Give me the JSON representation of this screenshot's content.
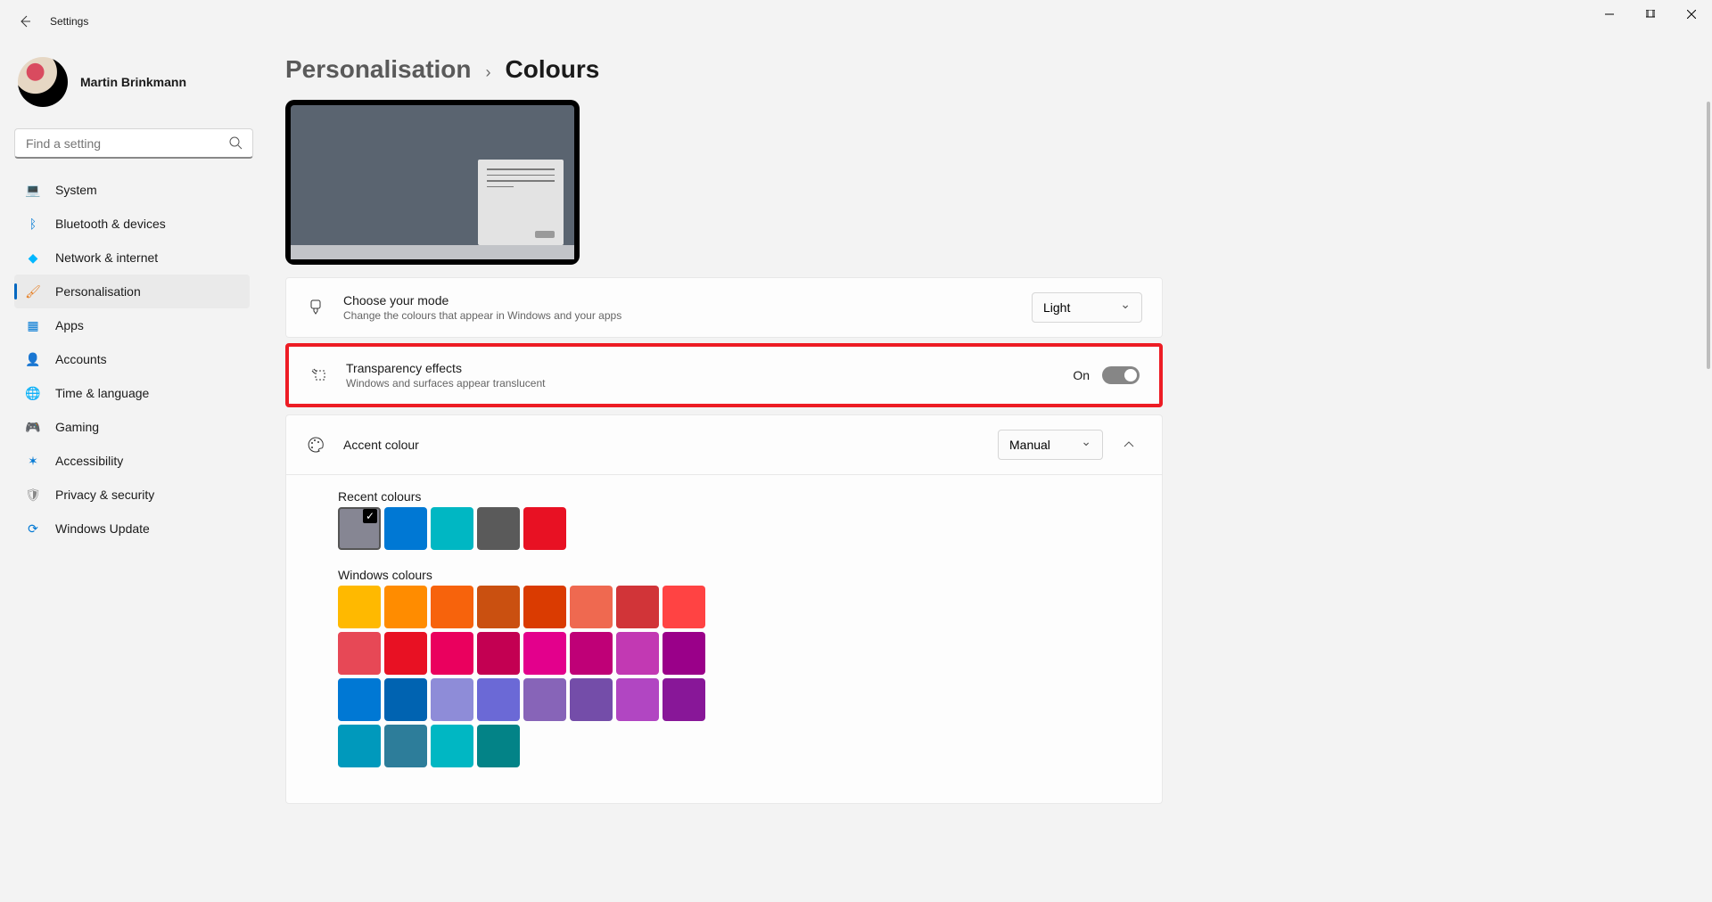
{
  "titlebar": {
    "title": "Settings"
  },
  "profile": {
    "name": "Martin Brinkmann"
  },
  "search": {
    "placeholder": "Find a setting"
  },
  "nav": [
    {
      "icon": "💻",
      "iconColor": "#0078d4",
      "label": "System"
    },
    {
      "icon": "ᛒ",
      "iconColor": "#0078d4",
      "label": "Bluetooth & devices"
    },
    {
      "icon": "◆",
      "iconColor": "#00b7ff",
      "label": "Network & internet"
    },
    {
      "icon": "🖌",
      "iconColor": "#e67e22",
      "label": "Personalisation",
      "active": true
    },
    {
      "icon": "▦",
      "iconColor": "#0078d4",
      "label": "Apps"
    },
    {
      "icon": "👤",
      "iconColor": "#16a085",
      "label": "Accounts"
    },
    {
      "icon": "🌐",
      "iconColor": "#0078d4",
      "label": "Time & language"
    },
    {
      "icon": "🎮",
      "iconColor": "#888",
      "label": "Gaming"
    },
    {
      "icon": "✶",
      "iconColor": "#0078d4",
      "label": "Accessibility"
    },
    {
      "icon": "🛡",
      "iconColor": "#888",
      "label": "Privacy & security"
    },
    {
      "icon": "⟳",
      "iconColor": "#0078d4",
      "label": "Windows Update"
    }
  ],
  "breadcrumb": {
    "parent": "Personalisation",
    "current": "Colours"
  },
  "rows": {
    "mode": {
      "title": "Choose your mode",
      "desc": "Change the colours that appear in Windows and your apps",
      "value": "Light"
    },
    "transparency": {
      "title": "Transparency effects",
      "desc": "Windows and surfaces appear translucent",
      "value": "On"
    },
    "accent": {
      "title": "Accent colour",
      "value": "Manual"
    }
  },
  "recent": {
    "label": "Recent colours",
    "colors": [
      "#868693",
      "#0078d4",
      "#00b7c3",
      "#5a5a5a",
      "#e81123"
    ],
    "selected": 0
  },
  "windows": {
    "label": "Windows colours",
    "colors": [
      "#ffb900",
      "#ff8c00",
      "#f7630c",
      "#ca5010",
      "#da3b01",
      "#ef6950",
      "#d13438",
      "#ff4343",
      "#e74856",
      "#e81123",
      "#ea005e",
      "#c30052",
      "#e3008c",
      "#bf0077",
      "#c239b3",
      "#9a0089",
      "#0078d4",
      "#0063b1",
      "#8e8cd8",
      "#6b69d6",
      "#8764b8",
      "#744da9",
      "#b146c2",
      "#881798",
      "#0099bc",
      "#2d7d9a",
      "#00b7c3",
      "#038387"
    ]
  }
}
